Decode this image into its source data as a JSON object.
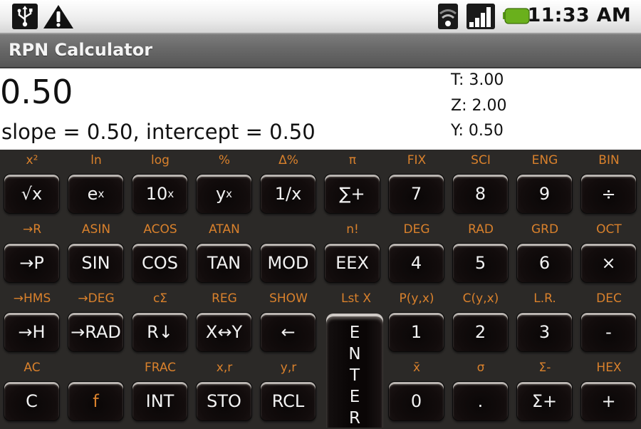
{
  "status_bar": {
    "icons": [
      "usb-icon",
      "warning-icon",
      "wifi-icon",
      "signal-icon",
      "battery-icon"
    ],
    "time": "11:33 AM",
    "battery_color": "#6ab01c"
  },
  "app": {
    "title": "RPN Calculator"
  },
  "display": {
    "x_register": "0.50",
    "message": "slope = 0.50, intercept = 0.50",
    "stack": {
      "t": "T: 3.00",
      "z": "Z: 2.00",
      "y": "Y: 0.50"
    }
  },
  "colors": {
    "function_label": "#d9812c",
    "key_text": "#f2f2f2",
    "keypad_background": "#2b2927"
  },
  "keypad": {
    "rows": [
      [
        {
          "name": "sqrt",
          "label": "√x",
          "shift": "x²"
        },
        {
          "name": "exp",
          "label": "e",
          "sup": "x",
          "shift": "ln"
        },
        {
          "name": "pow10",
          "label": "10",
          "sup": "x",
          "shift": "log"
        },
        {
          "name": "power",
          "label": "y",
          "sup": "x",
          "shift": "%"
        },
        {
          "name": "reciprocal",
          "label": "1/x",
          "shift": "Δ%"
        },
        {
          "name": "sigma-plus-top",
          "label": "∑+",
          "shift": "π"
        },
        {
          "name": "digit-7",
          "label": "7",
          "shift": "FIX"
        },
        {
          "name": "digit-8",
          "label": "8",
          "shift": "SCI"
        },
        {
          "name": "digit-9",
          "label": "9",
          "shift": "ENG"
        },
        {
          "name": "divide",
          "label": "÷",
          "shift": "BIN"
        }
      ],
      [
        {
          "name": "to-polar",
          "label": "→P",
          "shift": "→R"
        },
        {
          "name": "sin",
          "label": "SIN",
          "shift": "ASIN"
        },
        {
          "name": "cos",
          "label": "COS",
          "shift": "ACOS"
        },
        {
          "name": "tan",
          "label": "TAN",
          "shift": "ATAN"
        },
        {
          "name": "mod",
          "label": "MOD",
          "shift": ""
        },
        {
          "name": "eex",
          "label": "EEX",
          "shift": "n!"
        },
        {
          "name": "digit-4",
          "label": "4",
          "shift": "DEG"
        },
        {
          "name": "digit-5",
          "label": "5",
          "shift": "RAD"
        },
        {
          "name": "digit-6",
          "label": "6",
          "shift": "GRD"
        },
        {
          "name": "multiply",
          "label": "×",
          "shift": "OCT"
        }
      ],
      [
        {
          "name": "to-hours",
          "label": "→H",
          "shift": "→HMS"
        },
        {
          "name": "to-rad",
          "label": "→RAD",
          "shift": "→DEG"
        },
        {
          "name": "roll-down",
          "label": "R↓",
          "shift": "cΣ"
        },
        {
          "name": "swap-xy",
          "label": "X↔Y",
          "shift": "REG"
        },
        {
          "name": "backspace",
          "label": "←",
          "shift": "SHOW"
        },
        {
          "name": "enter-slot",
          "label": "",
          "shift": "Lst X"
        },
        {
          "name": "digit-1",
          "label": "1",
          "shift": "P(y,x)"
        },
        {
          "name": "digit-2",
          "label": "2",
          "shift": "C(y,x)"
        },
        {
          "name": "digit-3",
          "label": "3",
          "shift": "L.R."
        },
        {
          "name": "subtract",
          "label": "-",
          "shift": "DEC"
        }
      ],
      [
        {
          "name": "clear",
          "label": "C",
          "shift": "AC"
        },
        {
          "name": "function-shift",
          "label": "f",
          "shift": "",
          "fkey": true
        },
        {
          "name": "integer",
          "label": "INT",
          "shift": "FRAC"
        },
        {
          "name": "store",
          "label": "STO",
          "shift": "x,r"
        },
        {
          "name": "recall",
          "label": "RCL",
          "shift": "y,r"
        },
        {
          "name": "enter-slot-2",
          "label": "",
          "shift": ""
        },
        {
          "name": "digit-0",
          "label": "0",
          "shift": "x̄"
        },
        {
          "name": "decimal-point",
          "label": ".",
          "shift": "σ"
        },
        {
          "name": "sigma-plus",
          "label": "Σ+",
          "shift": "Σ-"
        },
        {
          "name": "add",
          "label": "+",
          "shift": "HEX"
        }
      ]
    ],
    "enter_key": {
      "label": "ENTER",
      "shift": "Lst X"
    }
  }
}
